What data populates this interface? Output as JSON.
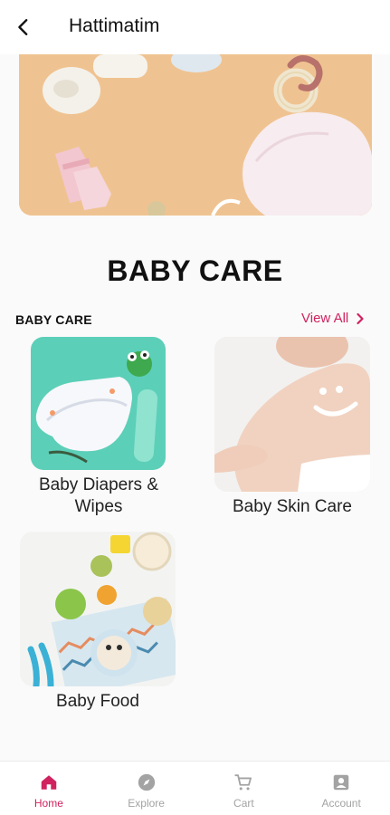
{
  "header": {
    "title": "Hattimatim"
  },
  "banner": {
    "alt": "baby care accessories banner"
  },
  "section": {
    "heading": "BABY CARE",
    "row_title": "BABY CARE",
    "view_all_label": "View All"
  },
  "categories": [
    {
      "label": "Baby Diapers & Wipes"
    },
    {
      "label": "Baby Skin Care"
    },
    {
      "label": "Baby Food"
    }
  ],
  "bottom_nav": {
    "items": [
      {
        "label": "Home",
        "icon": "home-icon",
        "active": true
      },
      {
        "label": "Explore",
        "icon": "compass-icon",
        "active": false
      },
      {
        "label": "Cart",
        "icon": "cart-icon",
        "active": false
      },
      {
        "label": "Account",
        "icon": "account-icon",
        "active": false
      }
    ]
  },
  "colors": {
    "accent": "#d0225f",
    "inactive_nav": "#a3a3a3",
    "background": "#fafafa"
  }
}
